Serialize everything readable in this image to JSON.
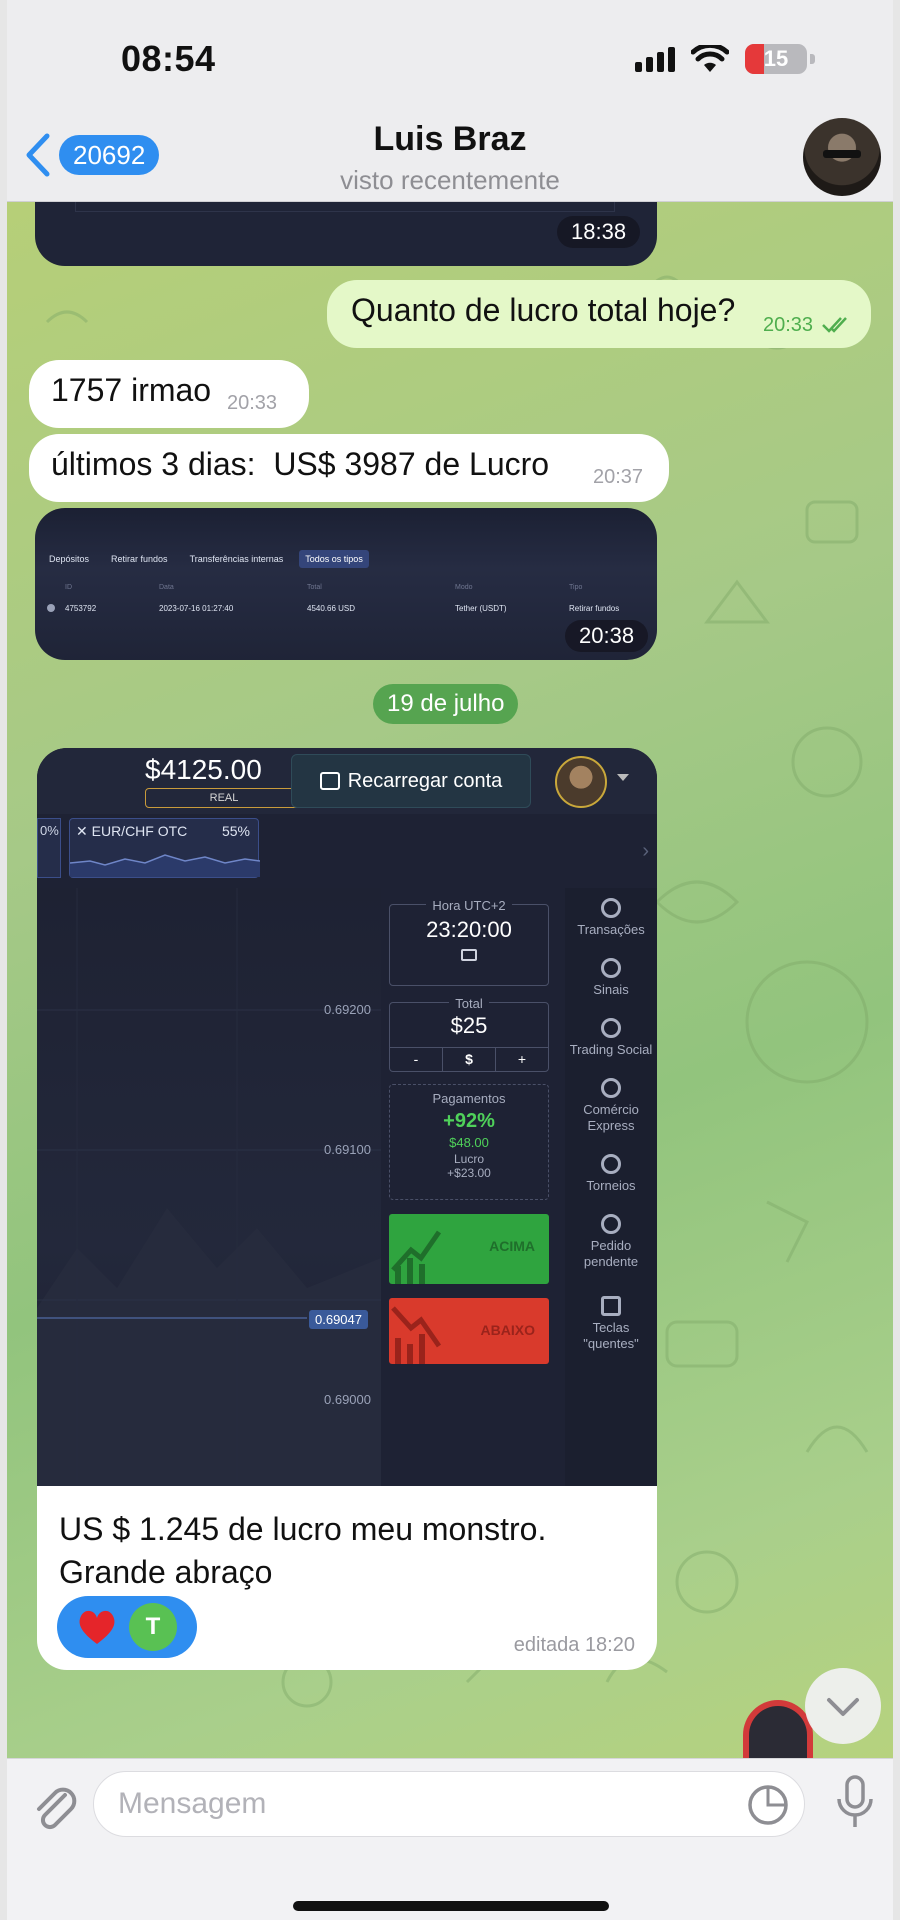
{
  "status_bar": {
    "time": "08:54",
    "battery": "15"
  },
  "header": {
    "back_count": "20692",
    "contact_name": "Luis Braz",
    "contact_status": "visto recentemente"
  },
  "messages": {
    "m0_time": "18:38",
    "m1_text": "Quanto de lucro total hoje?",
    "m1_time": "20:33",
    "m2_text": "1757 irmao",
    "m2_time": "20:33",
    "m3_text": "últimos 3 dias:  US$ 3987 de Lucro",
    "m3_time": "20:37",
    "m4_time": "20:38",
    "m4_tabs": [
      "Depósitos",
      "Retirar fundos",
      "Transferências internas",
      "Todos os tipos"
    ],
    "m4_columns": [
      "ID",
      "Data",
      "Total",
      "Modo",
      "Tipo"
    ],
    "m4_row": [
      "4753792",
      "2023-07-16 01:27:40",
      "4540.66 USD",
      "Tether (USDT)",
      "Retirar fundos"
    ]
  },
  "date_separator": "19 de julho",
  "trade": {
    "balance": "$4125.00",
    "account_type": "REAL",
    "recharge_label": "Recarregar conta",
    "tab_partial": "0%",
    "asset": "EUR/CHF OTC",
    "asset_payout": "55%",
    "prices": [
      "0.69200",
      "0.69100",
      "0.69047",
      "0.69000"
    ],
    "time_caption": "Hora UTC+2",
    "time_value": "23:20:00",
    "total_caption": "Total",
    "total_value": "$25",
    "minus": "-",
    "dollar": "$",
    "plus": "+",
    "payout_caption": "Pagamentos",
    "payout_pct": "+92%",
    "payout_amount": "$48.00",
    "profit_caption": "Lucro",
    "profit_value": "+$23.00",
    "up_label": "ACIMA",
    "down_label": "ABAIXO",
    "side": {
      "transactions": "Transações",
      "signals": "Sinais",
      "social": "Trading Social",
      "express": "Comércio Express",
      "tournaments": "Torneios",
      "pending": "Pedido pendente",
      "hotkeys": "Teclas \"quentes\""
    }
  },
  "caption": {
    "line1": "US $ 1.245 de lucro meu monstro.",
    "line2": "Grande abraço",
    "reaction_user": "T",
    "edited": "editada 18:20"
  },
  "composer": {
    "placeholder": "Mensagem"
  },
  "colors": {
    "accent": "#2f8ef0",
    "outgoing": "#e4f8c8",
    "read_check": "#4fae4e",
    "up": "#2fa43f",
    "down": "#d93a2c"
  }
}
